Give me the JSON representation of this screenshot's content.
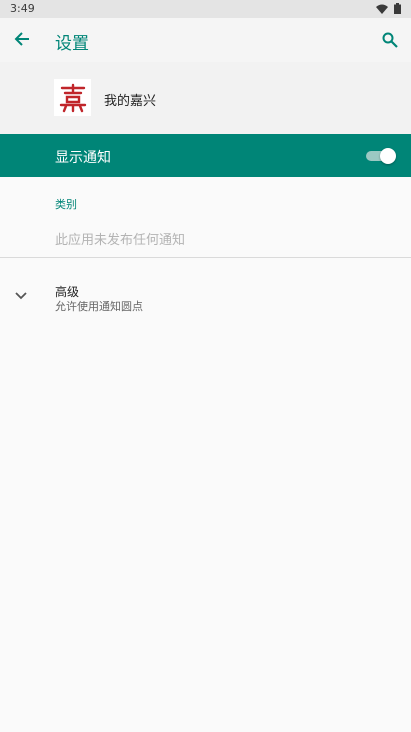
{
  "status_bar": {
    "time": "3:49"
  },
  "app_bar": {
    "title": "设置"
  },
  "app": {
    "name": "我的嘉兴",
    "icon_glyph": "嘉",
    "icon_color": "#c0252a"
  },
  "master_switch": {
    "label": "显示通知",
    "on": true
  },
  "categories": {
    "header": "类别",
    "empty_text": "此应用未发布任何通知"
  },
  "advanced": {
    "title": "高级",
    "summary": "允许使用通知圆点"
  },
  "colors": {
    "accent": "#008577",
    "background": "#fafafa"
  }
}
